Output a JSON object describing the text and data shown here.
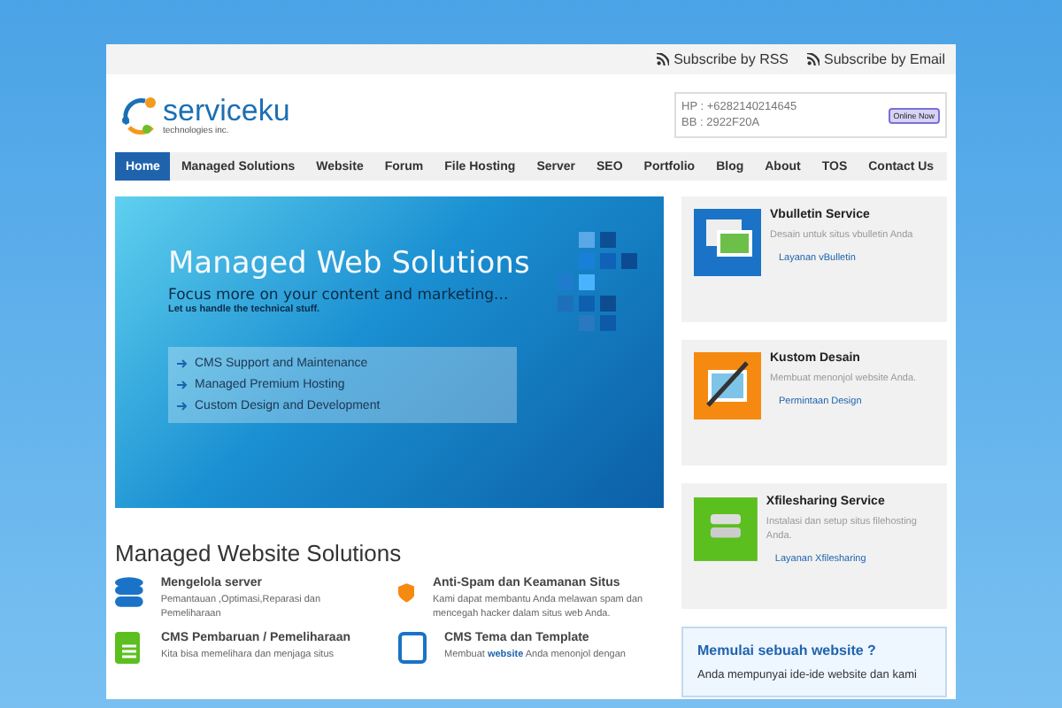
{
  "topbar": {
    "links": [
      "Subscribe by RSS",
      "Subscribe by Email"
    ]
  },
  "header": {
    "logo": {
      "name": "serviceku",
      "tagline": "technologies inc."
    },
    "contact": [
      "HP : +6282140214645",
      "BB : 2922F20A"
    ],
    "status_badge": "Online Now"
  },
  "nav": [
    {
      "label": "Home",
      "selected": true
    },
    {
      "label": "Managed Solutions",
      "selected": false
    },
    {
      "label": "Website",
      "selected": false
    },
    {
      "label": "Forum",
      "selected": false
    },
    {
      "label": "File Hosting",
      "selected": false
    },
    {
      "label": "Server",
      "selected": false
    },
    {
      "label": "SEO",
      "selected": false
    },
    {
      "label": "Portfolio",
      "selected": false
    },
    {
      "label": "Blog",
      "selected": false
    },
    {
      "label": "About",
      "selected": false
    },
    {
      "label": "TOS",
      "selected": false
    },
    {
      "label": "Contact Us",
      "selected": false
    }
  ],
  "banner": {
    "title": "Managed Web Solutions",
    "subtitle": "Focus more on your content and marketing...",
    "note": "Let us handle the technical stuff.",
    "points": [
      "CMS Support and Maintenance",
      "Managed Premium Hosting",
      "Custom Design and Development"
    ]
  },
  "services": {
    "title": "Managed Website Solutions",
    "items": [
      {
        "kind": "database",
        "title": "Mengelola server",
        "text": "Pemantauan ,Optimasi,Reparasi dan Pemeliharaan"
      },
      {
        "kind": "shield",
        "title": "Anti-Spam dan Keamanan Situs",
        "text": "Kami dapat membantu Anda melawan spam dan mencegah hacker dalam situs web Anda."
      },
      {
        "kind": "document",
        "title": "CMS Pembaruan / Pemeliharaan",
        "text": "Kita bisa memelihara dan menjaga situs"
      },
      {
        "kind": "window",
        "title": "CMS Tema dan Template",
        "text": "Membuat **website** Anda menonjol dengan"
      }
    ]
  },
  "sidebar": {
    "cards": [
      {
        "kind": "images",
        "title": "Vbulletin Service",
        "text": "Desain untuk situs vbulletin Anda",
        "link": "Layanan vBulletin"
      },
      {
        "kind": "brush",
        "title": "Kustom Desain",
        "text": "Membuat menonjol website Anda.",
        "link": "Permintaan Design"
      },
      {
        "kind": "server",
        "title": "Xfilesharing Service",
        "text": "Instalasi dan setup situs filehosting Anda.",
        "link": "Layanan Xfilesharing"
      }
    ],
    "promo": {
      "title": "Memulai sebuah website ?",
      "text": "Anda mempunyai ide-ide website dan kami"
    }
  }
}
